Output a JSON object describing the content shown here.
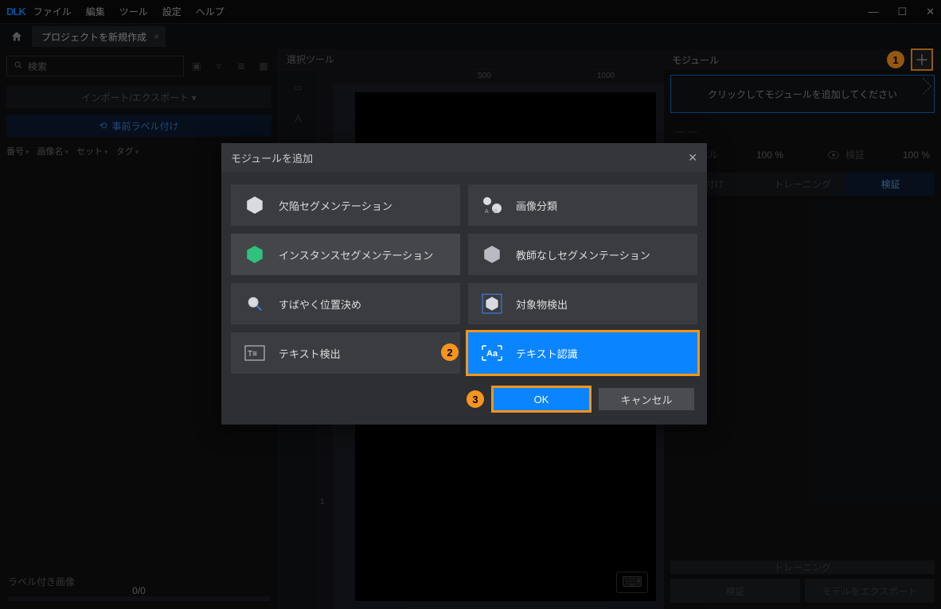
{
  "app": {
    "logo": "DLK"
  },
  "menu": [
    "ファイル",
    "編集",
    "ツール",
    "設定",
    "ヘルプ"
  ],
  "tab": {
    "title": "プロジェクトを新規作成"
  },
  "left": {
    "search_placeholder": "検索",
    "import_export": "インポート/エクスポート ▾",
    "prelabel": "事前ラベル付け",
    "cols": [
      "番号",
      "画像名",
      "セット",
      "タグ"
    ],
    "labeled_images": "ラベル付き画像",
    "progress": "0/0"
  },
  "center": {
    "select_tool": "選択ツール",
    "ruler_h": [
      "500",
      "1000"
    ],
    "ruler_v": [
      "1"
    ]
  },
  "right": {
    "module": "モジュール",
    "add_hint": "クリックしてモジュールを追加してください",
    "label": "ラベル",
    "label_pct": "100 %",
    "verify": "検証",
    "verify_pct": "100 %",
    "tabs": [
      "付け",
      "トレーニング",
      "検証"
    ],
    "big_training": "トレーニング",
    "big_verify": "検証",
    "big_export": "モデルをエクスポート"
  },
  "modal": {
    "title": "モジュールを追加",
    "options": [
      "欠陥セグメンテーション",
      "画像分類",
      "インスタンスセグメンテーション",
      "教師なしセグメンテーション",
      "すばやく位置決め",
      "対象物検出",
      "テキスト検出",
      "テキスト認識"
    ],
    "ok": "OK",
    "cancel": "キャンセル"
  },
  "callouts": {
    "one": "1",
    "two": "2",
    "three": "3"
  }
}
